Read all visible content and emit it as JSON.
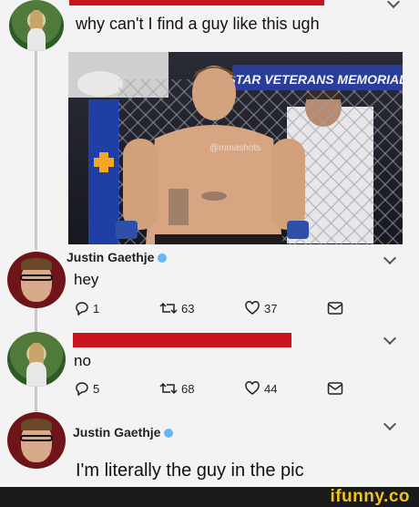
{
  "tweet1": {
    "text": "why can't I find a guy like this ugh"
  },
  "photo": {
    "banner_text": "STAR VETERANS MEMORIAL",
    "watermark": "@mmashots"
  },
  "reply1": {
    "name": "Justin Gaethje",
    "text": "hey",
    "replies": "1",
    "retweets": "63",
    "likes": "37"
  },
  "reply2": {
    "text": "no",
    "replies": "5",
    "retweets": "68",
    "likes": "44"
  },
  "reply3": {
    "name": "Justin Gaethje",
    "text": "I'm literally the guy in the pic"
  },
  "footer": {
    "brand": "ifunny.co"
  },
  "colors": {
    "redaction": "#c8141c",
    "verified": "#67b7f2",
    "brand": "#f0c21e"
  }
}
